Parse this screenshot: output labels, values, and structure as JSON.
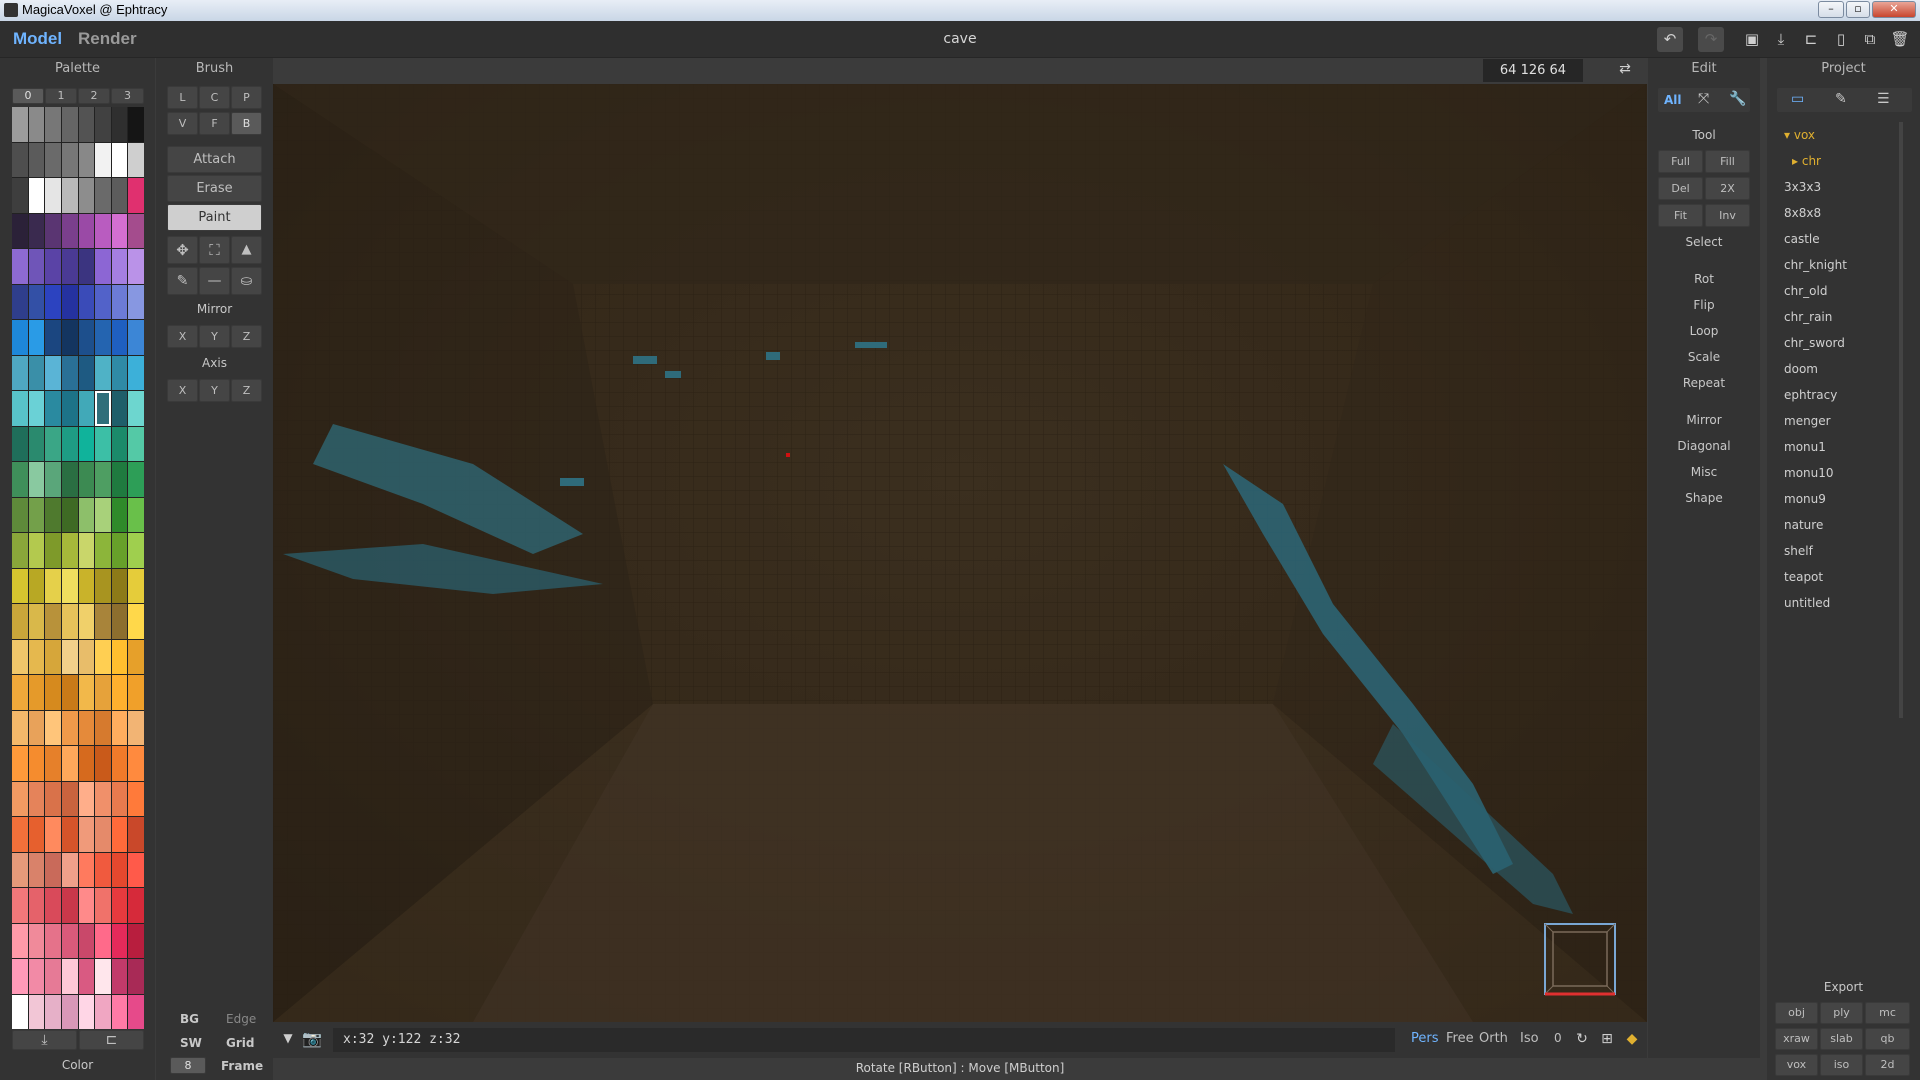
{
  "window": {
    "title": "MagicaVoxel @ Ephtracy"
  },
  "topbar": {
    "tabs": [
      {
        "label": "Model"
      },
      {
        "label": "Render"
      }
    ],
    "filename": "cave"
  },
  "palette": {
    "title": "Palette",
    "tabs": [
      "0",
      "1",
      "2",
      "3"
    ],
    "footer": "Color",
    "colors": [
      "#9c9c9c",
      "#8a8a8a",
      "#777777",
      "#656565",
      "#535353",
      "#414141",
      "#2f2f2f",
      "#151515",
      "#4e4e4e",
      "#5b5b5b",
      "#6a6a6a",
      "#777777",
      "#888888",
      "#f2f2f2",
      "#ffffff",
      "#cfcfcf",
      "#3e3e3e",
      "#ffffff",
      "#e5e5e5",
      "#b9b9b9",
      "#8d8d8d",
      "#6a6a6a",
      "#5c5c5c",
      "#e0306f",
      "#2b2138",
      "#3a2a4f",
      "#5a3572",
      "#7a3f8c",
      "#9a4aa6",
      "#b95cc0",
      "#d46fd1",
      "#a44c8d",
      "#8d6ad2",
      "#6f55b8",
      "#5a43a6",
      "#4a3a94",
      "#3b3480",
      "#8c66d4",
      "#a57fe1",
      "#ba92e8",
      "#2f3e8c",
      "#3350a6",
      "#2c43c0",
      "#2532a0",
      "#3a4bb8",
      "#5262c9",
      "#6c7bd6",
      "#8797e1",
      "#1e87d9",
      "#2a9be6",
      "#1b4680",
      "#143560",
      "#1d4f8c",
      "#2464b0",
      "#1f5fc0",
      "#3c86d6",
      "#4fa7c2",
      "#3a8fa8",
      "#5ab4d6",
      "#2a7096",
      "#1e5a82",
      "#4fb2c6",
      "#2f8aa6",
      "#3cb0d9",
      "#58c3c9",
      "#6ad1d6",
      "#2a8aa0",
      "#1d7388",
      "#41a9b8",
      "#2f6e7a",
      "#1f5e6a",
      "#6dd6cf",
      "#1f6e5a",
      "#2a8a6e",
      "#3aa686",
      "#1e9c84",
      "#10b39b",
      "#3cbfa6",
      "#1b8a6a",
      "#54c9a6",
      "#3f8f5a",
      "#89c9a0",
      "#5aa67a",
      "#2a6e42",
      "#3c8a52",
      "#4e9e62",
      "#1f7a3f",
      "#2d9e57",
      "#5e8a3a",
      "#73a04a",
      "#4f7a2e",
      "#3e6a24",
      "#8dbf6a",
      "#a8d17a",
      "#2f8a2a",
      "#69c04a",
      "#8aa63a",
      "#b3c94e",
      "#7e9a2a",
      "#a6b83a",
      "#c9d66a",
      "#8cb53a",
      "#67a02a",
      "#9fcf4e",
      "#d6c52f",
      "#b8a824",
      "#e5d04a",
      "#f0de5e",
      "#c9b32a",
      "#a89420",
      "#8c7a18",
      "#e5cc3a",
      "#c9a63a",
      "#d9b84a",
      "#b8923a",
      "#e6c25a",
      "#f0d06a",
      "#a8843a",
      "#8c6e2e",
      "#ffd84a",
      "#f0c66a",
      "#e5b84e",
      "#d6a63a",
      "#f2d08a",
      "#e8bd6a",
      "#ffcf52",
      "#ffbe2e",
      "#e6a02a",
      "#f0a83a",
      "#e59a2a",
      "#d68a1e",
      "#c97a18",
      "#f2b84a",
      "#e6a23a",
      "#ffb02e",
      "#f0a02a",
      "#f4b86a",
      "#e8a25a",
      "#ffc57a",
      "#f09a4a",
      "#e58a3a",
      "#d67a2e",
      "#ffad5e",
      "#f2b474",
      "#ff9a3a",
      "#f58c2e",
      "#e6802a",
      "#ffa85a",
      "#d66a1e",
      "#c95a1a",
      "#f07a2a",
      "#ff8a3e",
      "#f29a62",
      "#e5835a",
      "#d9724a",
      "#c9633e",
      "#ffae8a",
      "#f0906a",
      "#e87a4e",
      "#ff7a3a",
      "#f2703a",
      "#e6602e",
      "#ff8a5e",
      "#d6542a",
      "#f09a7a",
      "#e58a6a",
      "#ff6a3a",
      "#c9482a",
      "#e59a7a",
      "#d9826a",
      "#c96a5a",
      "#f0a08a",
      "#ff7a5e",
      "#f05a3e",
      "#e5482e",
      "#ff5a4a",
      "#f2787a",
      "#e5626a",
      "#d94a5a",
      "#c9384a",
      "#ff8a8a",
      "#f0726a",
      "#e63a3e",
      "#d62a3a",
      "#ff9aa8",
      "#f08a9a",
      "#e5728a",
      "#d95a7a",
      "#c9486a",
      "#ff6a8a",
      "#e52a5a",
      "#b81e3e",
      "#ff9ab8",
      "#f28aa6",
      "#e67a96",
      "#ffc8d6",
      "#d95a82",
      "#ffe6ec",
      "#c23a6a",
      "#a82a56",
      "#ffffff",
      "#f2c6d6",
      "#e6b0c8",
      "#d998b8",
      "#ffd6e6",
      "#f0a6c2",
      "#ff7aa6",
      "#e64a8a"
    ]
  },
  "brush": {
    "title": "Brush",
    "modes": [
      "L",
      "C",
      "P",
      "V",
      "F",
      "B"
    ],
    "actions": [
      "Attach",
      "Erase",
      "Paint"
    ],
    "mirror_label": "Mirror",
    "axis_label": "Axis",
    "xyz": [
      "X",
      "Y",
      "Z"
    ],
    "bottom": {
      "bg": "BG",
      "edge": "Edge",
      "sw": "SW",
      "grid": "Grid",
      "frame_num": "8",
      "frame": "Frame"
    }
  },
  "viewport": {
    "coords": "64  126  64"
  },
  "edit": {
    "title": "Edit",
    "tabs": [
      "All"
    ],
    "tool_label": "Tool",
    "tool_buttons": [
      "Full",
      "Fill",
      "Del",
      "2X",
      "Fit",
      "Inv"
    ],
    "items": [
      "Select",
      "Rot",
      "Flip",
      "Loop",
      "Scale",
      "Repeat",
      "Mirror",
      "Diagonal",
      "Misc",
      "Shape"
    ]
  },
  "project": {
    "title": "Project",
    "folder": "vox",
    "subfolder": "chr",
    "files": [
      "3x3x3",
      "8x8x8",
      "castle",
      "chr_knight",
      "chr_old",
      "chr_rain",
      "chr_sword",
      "doom",
      "ephtracy",
      "menger",
      "monu1",
      "monu10",
      "monu9",
      "nature",
      "shelf",
      "teapot",
      "untitled"
    ],
    "export_label": "Export",
    "export_formats": [
      "obj",
      "ply",
      "mc",
      "xraw",
      "slab",
      "qb",
      "vox",
      "iso",
      "2d"
    ]
  },
  "status": {
    "coords": "x:32   y:122  z:32",
    "view_modes": [
      "Pers",
      "Free",
      "Orth",
      "Iso"
    ],
    "num": "0"
  },
  "hint": "Rotate [RButton] : Move [MButton]",
  "colors": {
    "accent": "#6fb4ff",
    "panel": "#333333",
    "viewport": "#33291a"
  }
}
